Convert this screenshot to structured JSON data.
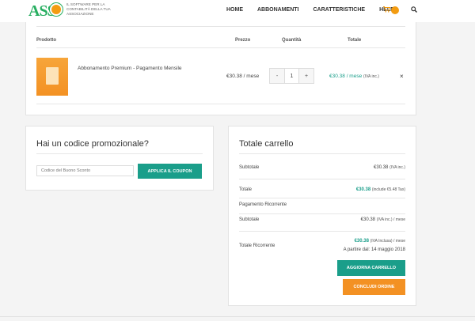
{
  "header": {
    "logo_text": "ASS",
    "tagline": "Il software per la contabilità della tua associazione",
    "nav": [
      "HOME",
      "ABBONAMENTI",
      "CARATTERISTICHE",
      "HELP"
    ]
  },
  "cart": {
    "headers": {
      "product": "Prodotto",
      "price": "Prezzo",
      "quantity": "Quantità",
      "total": "Totale"
    },
    "items": [
      {
        "name": "Abbonamento Premium - Pagamento Mensile",
        "price": "€30.38 / mese",
        "quantity": "1",
        "total": "€30.38",
        "total_suffix": " / mese",
        "total_note": "(IVA inc.)",
        "minus": "-",
        "plus": "+",
        "remove": "×"
      }
    ]
  },
  "coupon": {
    "title": "Hai un codice promozionale?",
    "placeholder": "Codice del Buono Sconto",
    "apply_label": "APPLICA IL COUPON"
  },
  "totals": {
    "title": "Totale carrello",
    "subtotal_label": "Subtotale",
    "subtotal_value": "€30.38",
    "subtotal_note": "(IVA inc.)",
    "total_label": "Totale",
    "total_value": "€30.38",
    "total_note": "(include €5.48 Tax)",
    "recurring_heading": "Pagamento Ricorrente",
    "rec_subtotal_label": "Subtotale",
    "rec_subtotal_value": "€30.38",
    "rec_subtotal_note": "(IVA inc.) / mese",
    "rec_total_label": "Totale Ricorrente",
    "rec_total_value": "€30.38",
    "rec_total_note": "(IVA Inclusa) / mese",
    "rec_start": "A partire dal: 14 maggio 2018",
    "update_label": "AGGIORNA CARRELLO",
    "checkout_label": "CONCLUDI ORDINE"
  },
  "colors": {
    "teal": "#1a9e8a",
    "orange": "#f39123"
  }
}
